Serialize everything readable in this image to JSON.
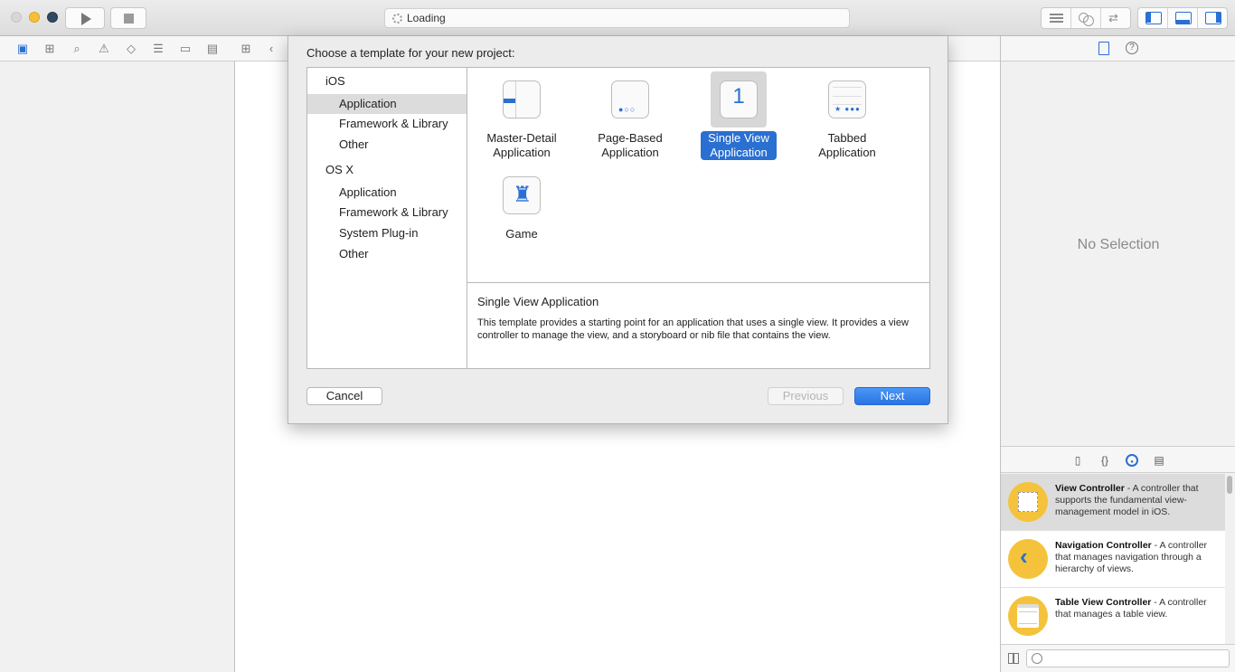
{
  "toolbar": {
    "activity_text": "Loading"
  },
  "navigator": {
    "icons": [
      "folder-icon",
      "hierarchy-icon",
      "search-icon",
      "warning-icon",
      "breakpoint-diamond-icon",
      "list-icon",
      "tag-icon",
      "comment-icon"
    ]
  },
  "sheet": {
    "title": "Choose a template for your new project:",
    "categories": [
      {
        "platform": "iOS",
        "items": [
          "Application",
          "Framework & Library",
          "Other"
        ]
      },
      {
        "platform": "OS X",
        "items": [
          "Application",
          "Framework & Library",
          "System Plug-in",
          "Other"
        ]
      }
    ],
    "selected_category": "iOS / Application",
    "templates": [
      {
        "line1": "Master-Detail",
        "line2": "Application",
        "icon": "master-detail-icon"
      },
      {
        "line1": "Page-Based",
        "line2": "Application",
        "icon": "page-based-icon"
      },
      {
        "line1": "Single View",
        "line2": "Application",
        "icon": "single-view-icon",
        "icon_glyph": "1"
      },
      {
        "line1": "Tabbed",
        "line2": "Application",
        "icon": "tabbed-icon"
      },
      {
        "line1": "Game",
        "line2": "",
        "icon": "game-icon"
      }
    ],
    "selected_template": "Single View Application",
    "description": {
      "title": "Single View Application",
      "body": "This template provides a starting point for an application that uses a single view. It provides a view controller to manage the view, and a storyboard or nib file that contains the view."
    },
    "buttons": {
      "cancel": "Cancel",
      "previous": "Previous",
      "next": "Next"
    }
  },
  "utilities": {
    "no_selection": "No Selection",
    "library": [
      {
        "name": "View Controller",
        "desc": " - A controller that supports the fundamental view-management model in iOS.",
        "icon": "view-controller-icon"
      },
      {
        "name": "Navigation Controller",
        "desc": " - A controller that manages navigation through a hierarchy of views.",
        "icon": "navigation-controller-icon"
      },
      {
        "name": "Table View Controller",
        "desc": " - A controller that manages a table view.",
        "icon": "table-view-controller-icon"
      }
    ]
  },
  "colors": {
    "accent": "#2a6fd2",
    "library_icon": "#f4c33b"
  }
}
